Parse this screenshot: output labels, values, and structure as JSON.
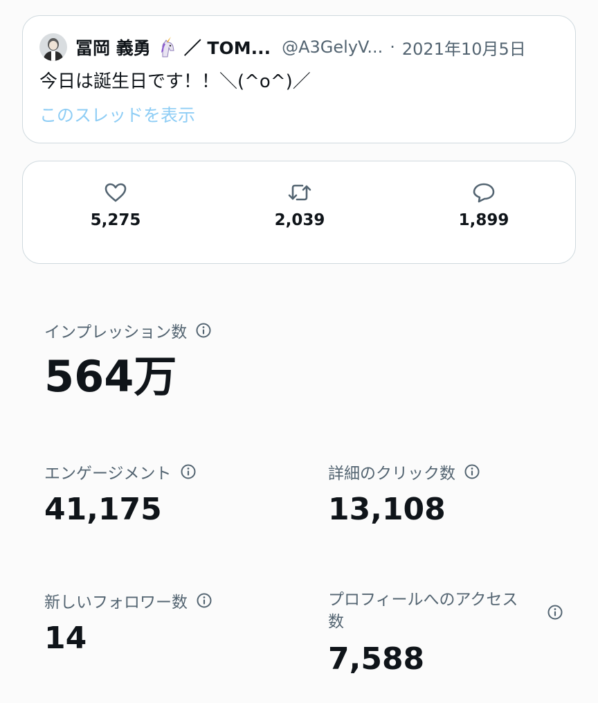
{
  "tweet": {
    "author_name": "冨岡 義勇",
    "author_suffix": "／ TOM...",
    "handle": "@A3GelyV...",
    "separator": "·",
    "date": "2021年10月5日",
    "text": "今日は誕生日です！！＼(^o^)／",
    "show_thread": "このスレッドを表示"
  },
  "engagement": {
    "likes": "5,275",
    "retweets": "2,039",
    "replies": "1,899"
  },
  "stats": {
    "impressions": {
      "label": "インプレッション数",
      "value": "564万"
    },
    "engagements": {
      "label": "エンゲージメント",
      "value": "41,175"
    },
    "detail_clicks": {
      "label": "詳細のクリック数",
      "value": "13,108"
    },
    "new_followers": {
      "label": "新しいフォロワー数",
      "value": "14"
    },
    "profile_visits": {
      "label": "プロフィールへのアクセス数",
      "value": "7,588"
    }
  },
  "icons": {
    "like": "heart-icon",
    "retweet": "retweet-icon",
    "reply": "reply-bubble-icon",
    "info": "info-icon",
    "emoji": "unicorn-icon"
  },
  "colors": {
    "text_primary": "#0f1419",
    "text_secondary": "#536471",
    "link": "#8ecdf5",
    "card_border": "#cfd9de"
  }
}
